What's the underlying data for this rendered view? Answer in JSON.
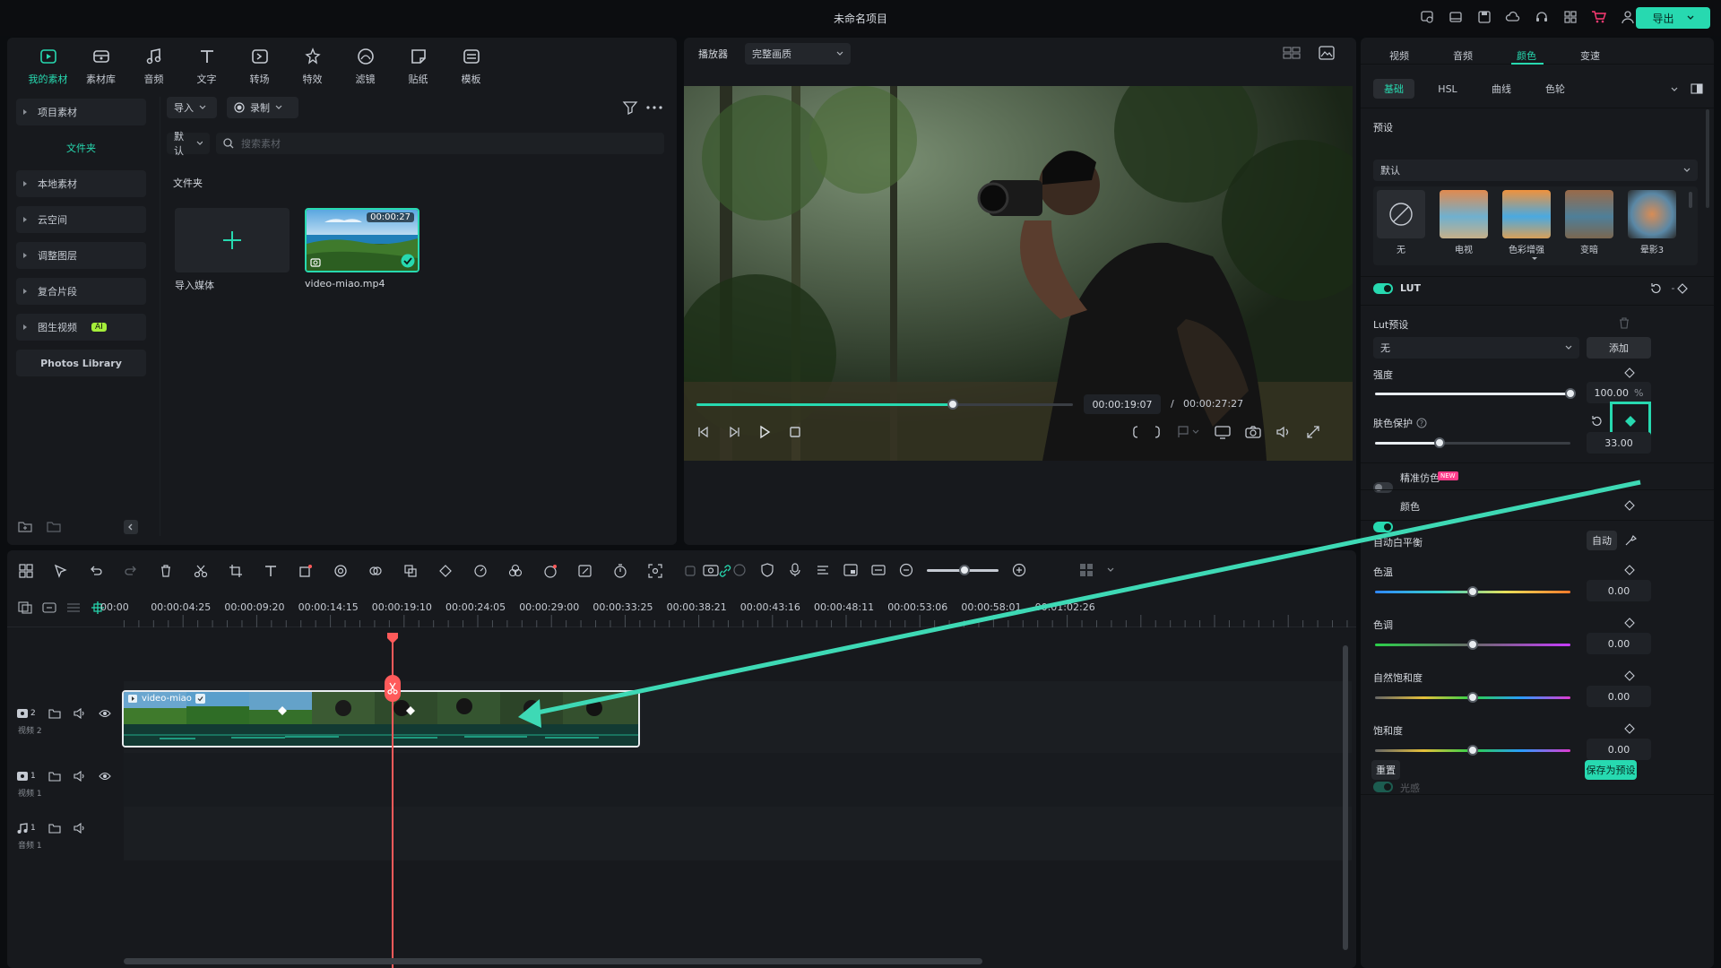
{
  "app": {
    "project_title": "未命名项目",
    "export_label": "导出"
  },
  "media_tabs": [
    {
      "label": "我的素材",
      "icon": "my-media-icon"
    },
    {
      "label": "素材库",
      "icon": "stock-library-icon"
    },
    {
      "label": "音频",
      "icon": "audio-icon"
    },
    {
      "label": "文字",
      "icon": "text-icon"
    },
    {
      "label": "转场",
      "icon": "transition-icon"
    },
    {
      "label": "特效",
      "icon": "effects-icon"
    },
    {
      "label": "滤镜",
      "icon": "filter-icon"
    },
    {
      "label": "贴纸",
      "icon": "sticker-icon"
    },
    {
      "label": "模板",
      "icon": "template-icon"
    }
  ],
  "media_sidebar": {
    "project": "项目素材",
    "folder": "文件夹",
    "local": "本地素材",
    "cloud": "云空间",
    "adjust": "调整图层",
    "compound": "复合片段",
    "img2video": "图生视频",
    "ai_badge": "AI",
    "photos": "Photos Library"
  },
  "media_main": {
    "import_label": "导入",
    "record_label": "录制",
    "sort_label": "默认",
    "search_placeholder": "搜索素材",
    "folder_title": "文件夹",
    "import_media_label": "导入媒体",
    "clip_name": "video-miao.mp4",
    "clip_duration": "00:00:27"
  },
  "player": {
    "label": "播放器",
    "quality": "完整画质",
    "current_time": "00:00:19:07",
    "separator": "/",
    "total_time": "00:00:27:27",
    "progress": 0.68
  },
  "timeline": {
    "ruler_labels": [
      "00:00",
      "00:00:04:25",
      "00:00:09:20",
      "00:00:14:15",
      "00:00:19:10",
      "00:00:24:05",
      "00:00:29:00",
      "00:00:33:25",
      "00:00:38:21",
      "00:00:43:16",
      "00:00:48:11",
      "00:00:53:06",
      "00:00:58:01",
      "00:01:02:26"
    ],
    "tracks": [
      {
        "num": "2",
        "name": "视频 2"
      },
      {
        "num": "1",
        "name": "视频 1"
      },
      {
        "num": "1",
        "name": "音频 1"
      }
    ],
    "clip_label": "video-miao"
  },
  "right_panel": {
    "tabs": [
      "视频",
      "音频",
      "颜色",
      "变速"
    ],
    "active_tab": "颜色",
    "subtabs": [
      "基础",
      "HSL",
      "曲线",
      "色轮"
    ],
    "active_subtab": "基础",
    "preset_title": "预设",
    "preset_select": "默认",
    "presets": [
      "无",
      "电视",
      "色彩增强",
      "变暗",
      "晕影3"
    ],
    "lut_title": "LUT",
    "lut_preset_title": "Lut预设",
    "lut_select": "无",
    "lut_add": "添加",
    "strength_title": "强度",
    "strength_value": "100.00",
    "strength_unit": "%",
    "strength_level": 1.0,
    "skin_title": "肤色保护",
    "skin_value": "33.00",
    "skin_level": 0.33,
    "precise_title": "精准仿色",
    "new_badge": "NEW",
    "color_title": "颜色",
    "awb_title": "自动白平衡",
    "awb_button": "自动",
    "temp_title": "色温",
    "temp_value": "0.00",
    "tint_title": "色调",
    "tint_value": "0.00",
    "vibrance_title": "自然饱和度",
    "vibrance_value": "0.00",
    "saturation_title": "饱和度",
    "saturation_value": "0.00",
    "next_title": "光感",
    "reset_label": "重置",
    "save_preset_label": "保存为预设"
  },
  "colors": {
    "accent": "#27d9b0",
    "playhead": "#ff5a5a",
    "panel": "#17191d"
  }
}
